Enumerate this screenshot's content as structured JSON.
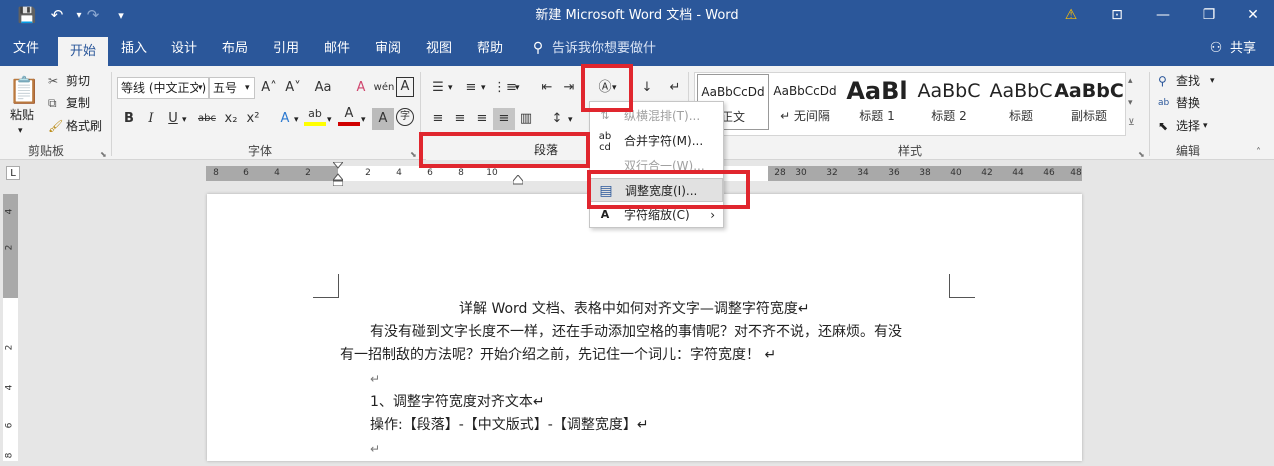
{
  "title_bar": {
    "title": "新建 Microsoft Word 文档 - Word",
    "save_icon": "💾",
    "undo_icon": "↶",
    "redo_icon": "↷",
    "customize_icon": "▾",
    "warning_icon": "⚠",
    "ribbon_display_icon": "⊡",
    "min_icon": "—",
    "restore_icon": "❐",
    "close_icon": "✕"
  },
  "tabs": [
    "文件",
    "开始",
    "插入",
    "设计",
    "布局",
    "引用",
    "邮件",
    "审阅",
    "视图",
    "帮助"
  ],
  "tell_me": "告诉我你想要做什么",
  "share": "共享",
  "clipboard": {
    "paste": "粘贴",
    "cut": "剪切",
    "copy": "复制",
    "format_painter": "格式刷",
    "label": "剪贴板"
  },
  "font": {
    "name": "等线 (中文正文)",
    "size": "五号",
    "label": "字体",
    "bold": "B",
    "italic": "I",
    "underline": "U",
    "strike": "abc",
    "sub": "x₂",
    "sup": "x²",
    "grow": "A˄",
    "shrink": "A˅",
    "case": "Aa",
    "clear": "A",
    "phonetic": "wén",
    "border": "A",
    "effects": "A",
    "highlight": "ab",
    "color": "A",
    "shade": "A",
    "enclose": "字"
  },
  "paragraph": {
    "label": "段落"
  },
  "styles": {
    "label": "样式",
    "items": [
      {
        "preview": "AaBbCcDd",
        "name": "正文"
      },
      {
        "preview": "AaBbCcDd",
        "name": "↵ 无间隔"
      },
      {
        "preview": "AaBl",
        "name": "标题 1"
      },
      {
        "preview": "AaBbC",
        "name": "标题 2"
      },
      {
        "preview": "AaBbC",
        "name": "标题"
      },
      {
        "preview": "AaBbC",
        "name": "副标题"
      }
    ]
  },
  "editing": {
    "find": "查找",
    "replace": "替换",
    "select": "选择",
    "label": "编辑"
  },
  "ruler": {
    "left_ticks": [
      "8",
      "6",
      "4",
      "2"
    ],
    "mid_ticks": [
      "2",
      "4",
      "6",
      "8",
      "10"
    ],
    "right_ticks": [
      "28",
      "30",
      "32",
      "34",
      "36",
      "38",
      "40",
      "42",
      "44",
      "46",
      "48"
    ],
    "corner": "L"
  },
  "vruler_ticks": [
    "4",
    "2",
    "2",
    "4",
    "6",
    "8"
  ],
  "menu": {
    "items": [
      {
        "icon": "⇅",
        "label": "纵横混排(T)...",
        "disabled": true
      },
      {
        "icon": "ab\ncd",
        "label": "合并字符(M)...",
        "disabled": false
      },
      {
        "icon": "",
        "label": "双行合一(W)...",
        "disabled": true
      },
      {
        "icon": "▤",
        "label": "调整宽度(I)...",
        "disabled": false
      },
      {
        "icon": "A",
        "label": "字符缩放(C)",
        "disabled": false
      }
    ],
    "submenu_arrow": "›"
  },
  "document": {
    "title_line": "详解 Word  文档、表格中如何对齐文字—调整字符宽度↵",
    "para1_line1": "有没有碰到文字长度不一样，还在手动添加空格的事情呢？对不齐不说，还麻烦。有没",
    "para1_line2": "有一招制敌的方法呢？开始介绍之前，先记住一个词儿：字符宽度！ ↵",
    "empty1": "↵",
    "heading1": "1、调整字符宽度对齐文本↵",
    "operation": "操作:【段落】-【中文版式】-【调整宽度】↵",
    "empty2": "↵"
  },
  "colors": {
    "accent": "#2b579a",
    "highlight_red": "#e0262e",
    "highlight_yellow": "#ffff00",
    "font_red": "#d00000"
  }
}
